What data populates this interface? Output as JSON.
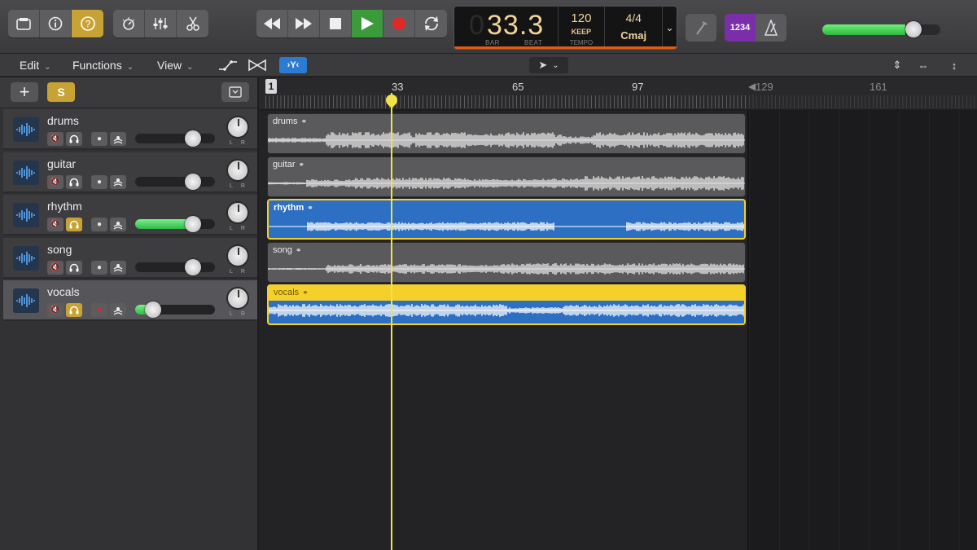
{
  "control_bar": {
    "transport": {
      "rewind": "⏪",
      "forward": "⏩",
      "stop": "■",
      "play": "▶",
      "record": "●",
      "cycle": "⟳"
    },
    "lcd": {
      "position": "33.3",
      "bar_label": "BAR",
      "beat_label": "BEAT",
      "tempo": "120",
      "tempo_mode": "KEEP",
      "tempo_label": "TEMPO",
      "time_signature": "4/4",
      "key": "Cmaj"
    },
    "count_in": "1234",
    "master_volume_level": 0.7
  },
  "tracks_bar": {
    "menus": [
      {
        "label": "Edit"
      },
      {
        "label": "Functions"
      },
      {
        "label": "View"
      }
    ]
  },
  "track_list": {
    "add_label": "+",
    "solo_label": "S",
    "tracks": [
      {
        "name": "drums",
        "volume": 0.72,
        "muted": false,
        "solo": false,
        "armed": false,
        "selected": false
      },
      {
        "name": "guitar",
        "volume": 0.72,
        "muted": false,
        "solo": false,
        "armed": false,
        "selected": false
      },
      {
        "name": "rhythm",
        "volume": 0.72,
        "muted": false,
        "solo": true,
        "armed": false,
        "selected": false
      },
      {
        "name": "song",
        "volume": 0.72,
        "muted": false,
        "solo": false,
        "armed": false,
        "selected": false
      },
      {
        "name": "vocals",
        "volume": 0.22,
        "muted": false,
        "solo": true,
        "armed": true,
        "selected": true
      }
    ]
  },
  "ruler": {
    "start_marker": "1",
    "bars": [
      "33",
      "65",
      "97"
    ],
    "bars_dim": [
      "129",
      "161"
    ]
  },
  "regions": [
    {
      "name": "drums",
      "style": "gray"
    },
    {
      "name": "guitar",
      "style": "gray"
    },
    {
      "name": "rhythm",
      "style": "blue"
    },
    {
      "name": "song",
      "style": "gray"
    },
    {
      "name": "vocals",
      "style": "yellow"
    }
  ],
  "colors": {
    "accent_yellow": "#c7a335",
    "play_green": "#3b9a3a",
    "record_red": "#e02828",
    "region_blue": "#2d6fc2",
    "playhead": "#f2e24a",
    "lcd_text": "#f2d49a"
  }
}
